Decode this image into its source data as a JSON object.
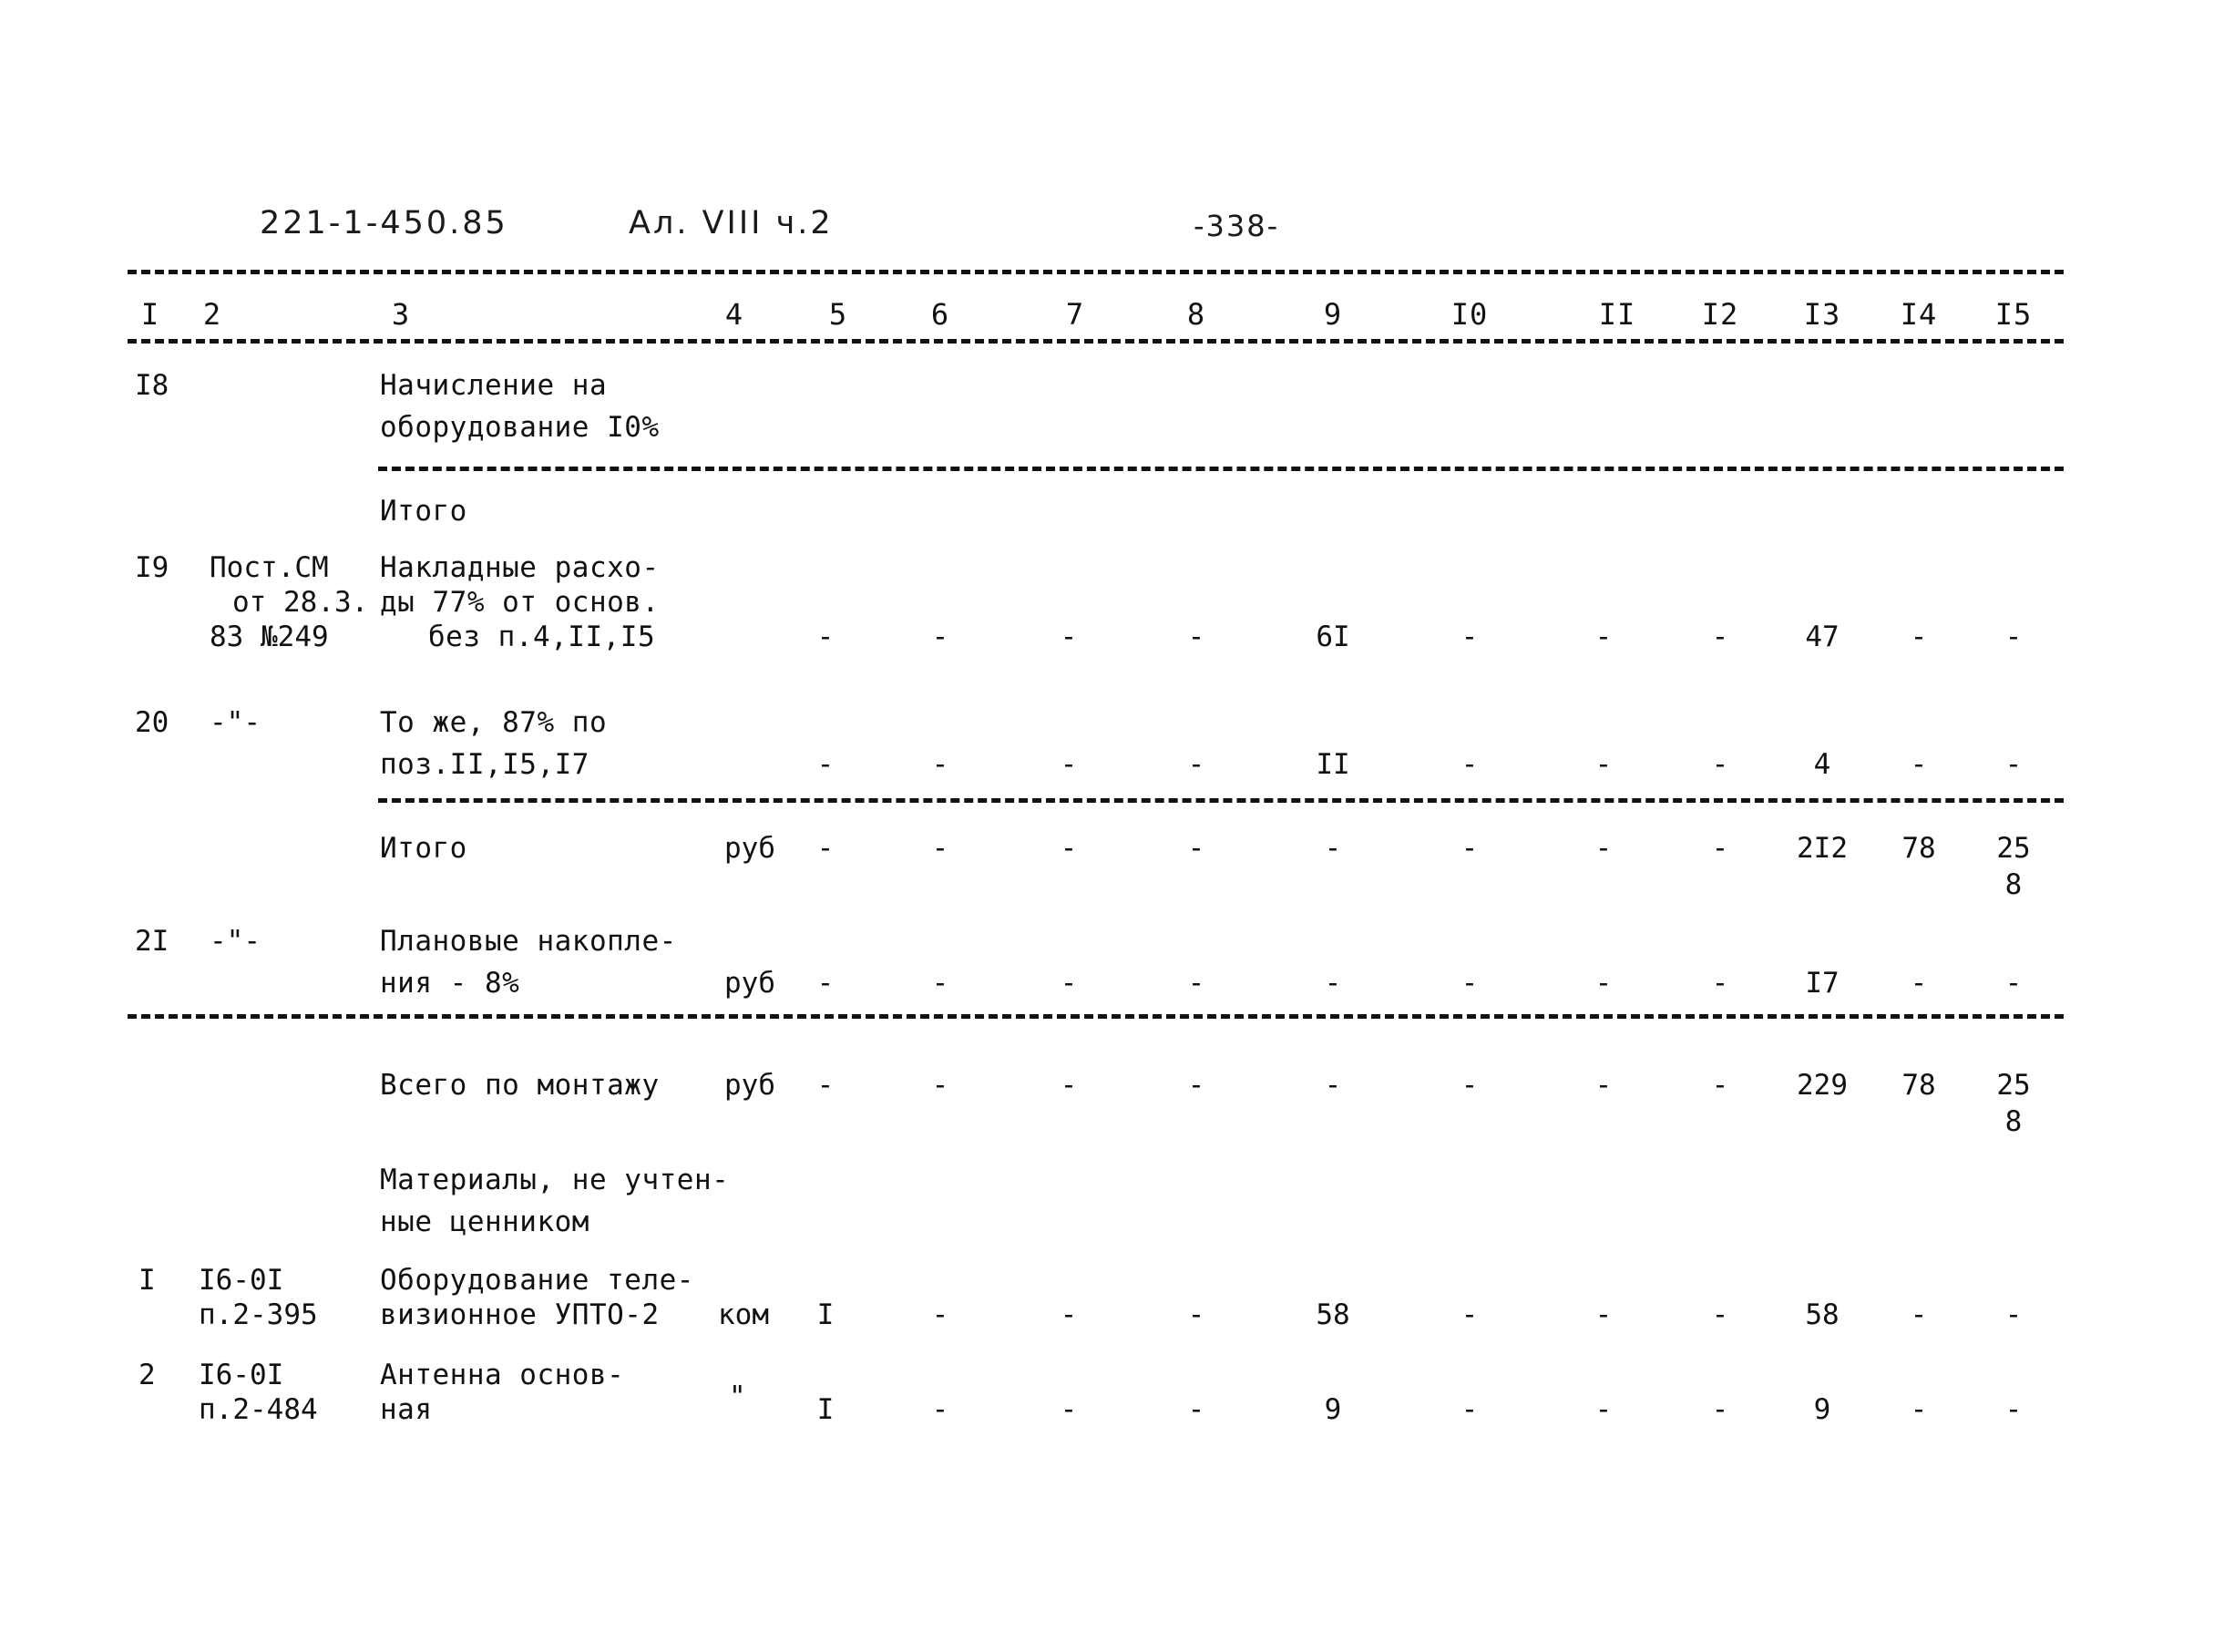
{
  "document": {
    "code": "221-1-450.85",
    "album": "Ал. VIII ч.2",
    "page_number": "-338-"
  },
  "table": {
    "column_headers": [
      "I",
      "2",
      "3",
      "4",
      "5",
      "6",
      "7",
      "8",
      "9",
      "I0",
      "II",
      "I2",
      "I3",
      "I4",
      "I5"
    ],
    "rows": [
      {
        "pos": "I8",
        "justification": "",
        "description_lines": [
          "Начисление на",
          "оборудование I0%"
        ],
        "unit": "",
        "values": [
          "",
          "",
          "",
          "",
          "",
          "",
          "",
          "",
          "",
          "",
          ""
        ]
      },
      {
        "pos": "",
        "justification": "",
        "description_lines": [
          "Итого"
        ],
        "unit": "",
        "values": [
          "",
          "",
          "",
          "",
          "",
          "",
          "",
          "",
          "",
          "",
          ""
        ]
      },
      {
        "pos": "I9",
        "justification_lines": [
          "Пост.СМ",
          "от 28.3.",
          "83 №249"
        ],
        "description_lines": [
          "Накладные расхо-",
          "ды 77% от основ.",
          "   без п.4,II,I5"
        ],
        "unit": "",
        "values": [
          "-",
          "-",
          "-",
          "-",
          "6I",
          "-",
          "-",
          "-",
          "47",
          "-",
          "-"
        ]
      },
      {
        "pos": "20",
        "justification_lines": [
          "-\"-"
        ],
        "description_lines": [
          "То же, 87% по",
          "поз.II,I5,I7"
        ],
        "unit": "",
        "values": [
          "-",
          "-",
          "-",
          "-",
          "II",
          "-",
          "-",
          "-",
          "4",
          "-",
          "-"
        ]
      },
      {
        "pos": "",
        "justification_lines": [],
        "description_lines": [
          "Итого"
        ],
        "unit": "руб",
        "values": [
          "-",
          "-",
          "-",
          "-",
          "-",
          "-",
          "-",
          "-",
          "2I2",
          "78",
          "25"
        ],
        "value_15_second_line": "8"
      },
      {
        "pos": "2I",
        "justification_lines": [
          "-\"-"
        ],
        "description_lines": [
          "Плановые накопле-",
          "ния - 8%"
        ],
        "unit": "руб",
        "values": [
          "-",
          "-",
          "-",
          "-",
          "-",
          "-",
          "-",
          "-",
          "I7",
          "-",
          "-"
        ]
      },
      {
        "pos": "",
        "justification_lines": [],
        "description_lines": [
          "Всего по монтажу"
        ],
        "unit": "руб",
        "values": [
          "-",
          "-",
          "-",
          "-",
          "-",
          "-",
          "-",
          "-",
          "229",
          "78",
          "25"
        ],
        "value_15_second_line": "8"
      },
      {
        "pos": "",
        "justification_lines": [],
        "description_lines": [
          "Материалы, не учтен-",
          "ные ценником"
        ],
        "unit": "",
        "values": [
          "",
          "",
          "",
          "",
          "",
          "",
          "",
          "",
          "",
          "",
          ""
        ]
      },
      {
        "pos": "I",
        "justification_lines": [
          "I6-0I",
          "п.2-395"
        ],
        "description_lines": [
          "Оборудование теле-",
          "визионное УПТО-2"
        ],
        "unit": "ком",
        "qty": "I",
        "values": [
          "-",
          "-",
          "-",
          "58",
          "-",
          "-",
          "-",
          "58",
          "-",
          "-"
        ]
      },
      {
        "pos": "2",
        "justification_lines": [
          "I6-0I",
          "п.2-484"
        ],
        "description_lines": [
          "Антенна основ-",
          "ная"
        ],
        "unit": "\"",
        "qty": "I",
        "values": [
          "-",
          "-",
          "-",
          "9",
          "-",
          "-",
          "-",
          "9",
          "-",
          "-"
        ]
      }
    ]
  },
  "labels": {
    "total_1": "Итого",
    "total_2": "Итого",
    "grand_total": "Всего по монтажу",
    "materials_heading_1": "Материалы, не учтен-",
    "materials_heading_2": "ные ценником",
    "currency_unit": "руб"
  },
  "cells": {
    "h1": "I",
    "h2": "2",
    "h3": "3",
    "h4": "4",
    "h5": "5",
    "h6": "6",
    "h7": "7",
    "h8": "8",
    "h9": "9",
    "h10": "I0",
    "h11": "II",
    "h12": "I2",
    "h13": "I3",
    "h14": "I4",
    "h15": "I5",
    "r18_pos": "I8",
    "r18_d1": "Начисление на",
    "r18_d2": "оборудование I0%",
    "rtot1_d1": "Итого",
    "r19_pos": "I9",
    "r19_j1": "Пост.СМ",
    "r19_j2": "от 28.3.",
    "r19_j3": "83 №249",
    "r19_d1": "Накладные расхо-",
    "r19_d2": "ды 77% от основ.",
    "r19_d3": "без п.4,II,I5",
    "r19_c4": "-",
    "r19_c5": "-",
    "r19_c6": "-",
    "r19_c7": "-",
    "r19_c8": "-",
    "r19_c9": "6I",
    "r19_c10": "-",
    "r19_c11": "-",
    "r19_c12": "-",
    "r19_c13": "47",
    "r19_c14": "-",
    "r19_c15": "-",
    "r20_pos": "20",
    "r20_j1": "-\"-",
    "r20_d1": "То же, 87% по",
    "r20_d2": "поз.II,I5,I7",
    "r20_c4": "-",
    "r20_c5": "-",
    "r20_c6": "-",
    "r20_c7": "-",
    "r20_c8": "-",
    "r20_c9": "II",
    "r20_c10": "-",
    "r20_c11": "-",
    "r20_c12": "-",
    "r20_c13": "4",
    "r20_c14": "-",
    "r20_c15": "-",
    "rtot2_d1": "Итого",
    "rtot2_unit": "руб",
    "rtot2_c4": "-",
    "rtot2_c5": "-",
    "rtot2_c6": "-",
    "rtot2_c7": "-",
    "rtot2_c8": "-",
    "rtot2_c9": "-",
    "rtot2_c10": "-",
    "rtot2_c11": "-",
    "rtot2_c12": "-",
    "rtot2_c13": "2I2",
    "rtot2_c14": "78",
    "rtot2_c15": "25",
    "rtot2_c15b": "8",
    "r21_pos": "2I",
    "r21_j1": "-\"-",
    "r21_d1": "Плановые накопле-",
    "r21_d2": "ния - 8%",
    "r21_unit": "руб",
    "r21_c4": "-",
    "r21_c5": "-",
    "r21_c6": "-",
    "r21_c7": "-",
    "r21_c8": "-",
    "r21_c9": "-",
    "r21_c10": "-",
    "r21_c11": "-",
    "r21_c12": "-",
    "r21_c13": "I7",
    "r21_c14": "-",
    "r21_c15": "-",
    "rall_d1": "Всего по монтажу",
    "rall_unit": "руб",
    "rall_c4": "-",
    "rall_c5": "-",
    "rall_c6": "-",
    "rall_c7": "-",
    "rall_c8": "-",
    "rall_c9": "-",
    "rall_c10": "-",
    "rall_c11": "-",
    "rall_c12": "-",
    "rall_c13": "229",
    "rall_c14": "78",
    "rall_c15": "25",
    "rall_c15b": "8",
    "rmat_d1": "Материалы, не учтен-",
    "rmat_d2": "ные ценником",
    "rm1_pos": "I",
    "rm1_j1": "I6-0I",
    "rm1_j2": "п.2-395",
    "rm1_d1": "Оборудование теле-",
    "rm1_d2": "визионное УПТО-2",
    "rm1_unit": "ком",
    "rm1_c4": "I",
    "rm1_c5": "-",
    "rm1_c6": "-",
    "rm1_c7": "-",
    "rm1_c8": "-",
    "rm1_c9": "58",
    "rm1_c10": "-",
    "rm1_c11": "-",
    "rm1_c12": "-",
    "rm1_c13": "58",
    "rm1_c14": "-",
    "rm1_c15": "-",
    "rm2_pos": "2",
    "rm2_j1": "I6-0I",
    "rm2_j2": "п.2-484",
    "rm2_d1": "Антенна основ-",
    "rm2_d2": "ная",
    "rm2_unit": "\"",
    "rm2_c4": "I",
    "rm2_c5": "-",
    "rm2_c6": "-",
    "rm2_c7": "-",
    "rm2_c8": "-",
    "rm2_c9": "9",
    "rm2_c10": "-",
    "rm2_c11": "-",
    "rm2_c12": "-",
    "rm2_c13": "9",
    "rm2_c14": "-",
    "rm2_c15": "-"
  }
}
